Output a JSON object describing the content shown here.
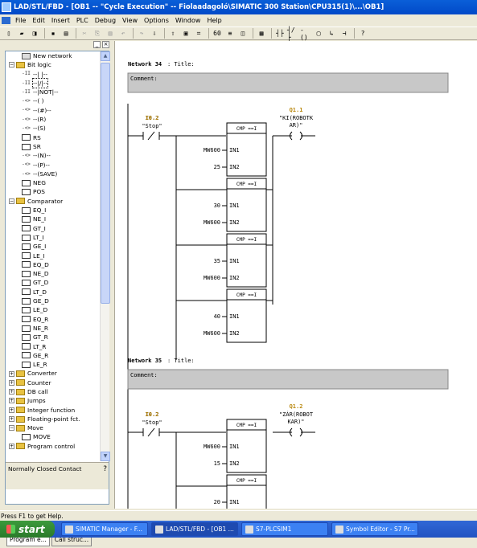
{
  "window": {
    "title": "LAD/STL/FBD  - [OB1 -- \"Cycle Execution\" -- Fiolaadagoló\\SIMATIC 300 Station\\CPU315(1)\\...\\OB1]"
  },
  "menu": [
    "File",
    "Edit",
    "Insert",
    "PLC",
    "Debug",
    "View",
    "Options",
    "Window",
    "Help"
  ],
  "toolbar": {
    "icons": [
      "new-icon",
      "open-icon",
      "online-icon",
      "save-icon",
      "print-icon",
      "cut-icon",
      "copy-icon",
      "paste-icon",
      "undo-icon",
      "redo-icon",
      "download-icon",
      "upload-icon",
      "monitor-icon",
      "network-icon",
      "zoom-icon",
      "overview-icon",
      "lad-icon",
      "insert-network-icon",
      "contact-no-icon",
      "contact-nc-icon",
      "coil-icon",
      "box-icon",
      "branch-open-icon",
      "branch-close-icon",
      "help-icon"
    ]
  },
  "tree": {
    "items": [
      {
        "label": "New network",
        "level": 1,
        "icon": "net"
      },
      {
        "label": "Bit logic",
        "level": 0,
        "icon": "folder",
        "exp": "−"
      },
      {
        "label": "--| |--",
        "level": 1,
        "icon": "con",
        "sym": "-II"
      },
      {
        "label": "--|/|--",
        "level": 1,
        "icon": "con",
        "sym": "-II",
        "selected": true
      },
      {
        "label": "--|NOT|--",
        "level": 1,
        "icon": "con",
        "sym": "-II"
      },
      {
        "label": "--( )",
        "level": 1,
        "icon": "con",
        "sym": "-<>"
      },
      {
        "label": "--(#)--",
        "level": 1,
        "icon": "con",
        "sym": "-<>"
      },
      {
        "label": "--(R)",
        "level": 1,
        "icon": "con",
        "sym": "-<>"
      },
      {
        "label": "--(S)",
        "level": 1,
        "icon": "con",
        "sym": "-<>"
      },
      {
        "label": "RS",
        "level": 1,
        "icon": "box"
      },
      {
        "label": "SR",
        "level": 1,
        "icon": "box"
      },
      {
        "label": "--(N)--",
        "level": 1,
        "icon": "con",
        "sym": "-<>"
      },
      {
        "label": "--(P)--",
        "level": 1,
        "icon": "con",
        "sym": "-<>"
      },
      {
        "label": "--(SAVE)",
        "level": 1,
        "icon": "con",
        "sym": "-<>"
      },
      {
        "label": "NEG",
        "level": 1,
        "icon": "box"
      },
      {
        "label": "POS",
        "level": 1,
        "icon": "box"
      },
      {
        "label": "Comparator",
        "level": 0,
        "icon": "folder",
        "exp": "−"
      },
      {
        "label": "EQ_I",
        "level": 1,
        "icon": "box"
      },
      {
        "label": "NE_I",
        "level": 1,
        "icon": "box"
      },
      {
        "label": "GT_I",
        "level": 1,
        "icon": "box"
      },
      {
        "label": "LT_I",
        "level": 1,
        "icon": "box"
      },
      {
        "label": "GE_I",
        "level": 1,
        "icon": "box"
      },
      {
        "label": "LE_I",
        "level": 1,
        "icon": "box"
      },
      {
        "label": "EQ_D",
        "level": 1,
        "icon": "box"
      },
      {
        "label": "NE_D",
        "level": 1,
        "icon": "box"
      },
      {
        "label": "GT_D",
        "level": 1,
        "icon": "box"
      },
      {
        "label": "LT_D",
        "level": 1,
        "icon": "box"
      },
      {
        "label": "GE_D",
        "level": 1,
        "icon": "box"
      },
      {
        "label": "LE_D",
        "level": 1,
        "icon": "box"
      },
      {
        "label": "EQ_R",
        "level": 1,
        "icon": "box"
      },
      {
        "label": "NE_R",
        "level": 1,
        "icon": "box"
      },
      {
        "label": "GT_R",
        "level": 1,
        "icon": "box"
      },
      {
        "label": "LT_R",
        "level": 1,
        "icon": "box"
      },
      {
        "label": "GE_R",
        "level": 1,
        "icon": "box"
      },
      {
        "label": "LE_R",
        "level": 1,
        "icon": "box"
      },
      {
        "label": "Converter",
        "level": 0,
        "icon": "folder",
        "exp": "+"
      },
      {
        "label": "Counter",
        "level": 0,
        "icon": "folder",
        "exp": "+"
      },
      {
        "label": "DB call",
        "level": 0,
        "icon": "folder",
        "exp": "+"
      },
      {
        "label": "Jumps",
        "level": 0,
        "icon": "folder",
        "exp": "+"
      },
      {
        "label": "Integer function",
        "level": 0,
        "icon": "folder",
        "exp": "+"
      },
      {
        "label": "Floating-point fct.",
        "level": 0,
        "icon": "folder",
        "exp": "+"
      },
      {
        "label": "Move",
        "level": 0,
        "icon": "folder",
        "exp": "−"
      },
      {
        "label": "MOVE",
        "level": 1,
        "icon": "box"
      },
      {
        "label": "Program control",
        "level": 0,
        "icon": "folder",
        "exp": "+"
      }
    ]
  },
  "info": {
    "text": "Normally Closed Contact"
  },
  "tabs": [
    "Program e...",
    "Call struc..."
  ],
  "networks": [
    {
      "header": "Network 34",
      "title_label": ": Title:",
      "comment": "Comment:",
      "contact": {
        "addr": "I0.2",
        "sym": "\"Stop\""
      },
      "coil": {
        "addr": "Q1.1",
        "sym1": "\"KI(ROBOTK",
        "sym2": "AR)\""
      },
      "boxes": [
        {
          "title": "CMP ==I",
          "in1": "MW600",
          "in2": "25"
        },
        {
          "title": "CMP ==I",
          "in1": "30",
          "in2": "MW600"
        },
        {
          "title": "CMP ==I",
          "in1": "35",
          "in2": "MW600"
        },
        {
          "title": "CMP ==I",
          "in1": "40",
          "in2": "MW600"
        }
      ]
    },
    {
      "header": "Network 35",
      "title_label": ": Title:",
      "comment": "Comment:",
      "contact": {
        "addr": "I0.2",
        "sym": "\"Stop\""
      },
      "coil": {
        "addr": "Q1.2",
        "sym1": "\"ZÁR(ROBOT",
        "sym2": "KAR)\""
      },
      "boxes": [
        {
          "title": "CMP ==I",
          "in1": "MW600",
          "in2": "15"
        },
        {
          "title": "CMP ==I",
          "in1": "20",
          "in2": ""
        }
      ]
    }
  ],
  "status": "Press F1 to get Help.",
  "taskbar": {
    "start": "start",
    "tasks": [
      "SIMATIC Manager - F...",
      "LAD/STL/FBD - [OB1 ...",
      "S7-PLCSIM1",
      "Symbol Editor - S7 Pr..."
    ]
  }
}
